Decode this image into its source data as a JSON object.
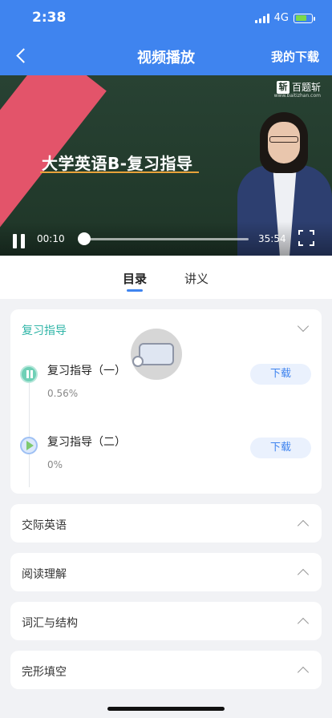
{
  "status_bar": {
    "time": "2:38",
    "network": "4G"
  },
  "header": {
    "title": "视频播放",
    "right_action": "我的下载"
  },
  "video": {
    "title_overlay": "大学英语B-复习指导",
    "brand": "百题斩",
    "brand_url": "www.baitizhan.com",
    "current_time": "00:10",
    "total_time": "35:54",
    "progress": 0.005
  },
  "tabs": [
    {
      "label": "目录",
      "active": true
    },
    {
      "label": "讲义",
      "active": false
    }
  ],
  "active_section": {
    "title": "复习指导",
    "lessons": [
      {
        "name": "复习指导（一）",
        "progress": "0.56%",
        "button": "下载",
        "state": "playing"
      },
      {
        "name": "复习指导（二）",
        "progress": "0%",
        "button": "下载",
        "state": "ready"
      }
    ]
  },
  "collapsed_sections": [
    {
      "title": "交际英语"
    },
    {
      "title": "阅读理解"
    },
    {
      "title": "词汇与结构"
    },
    {
      "title": "完形填空"
    }
  ],
  "colors": {
    "primary": "#3f84ef",
    "accent_teal": "#2fb5a7",
    "video_board": "#203528",
    "stripe": "#e3546a"
  }
}
